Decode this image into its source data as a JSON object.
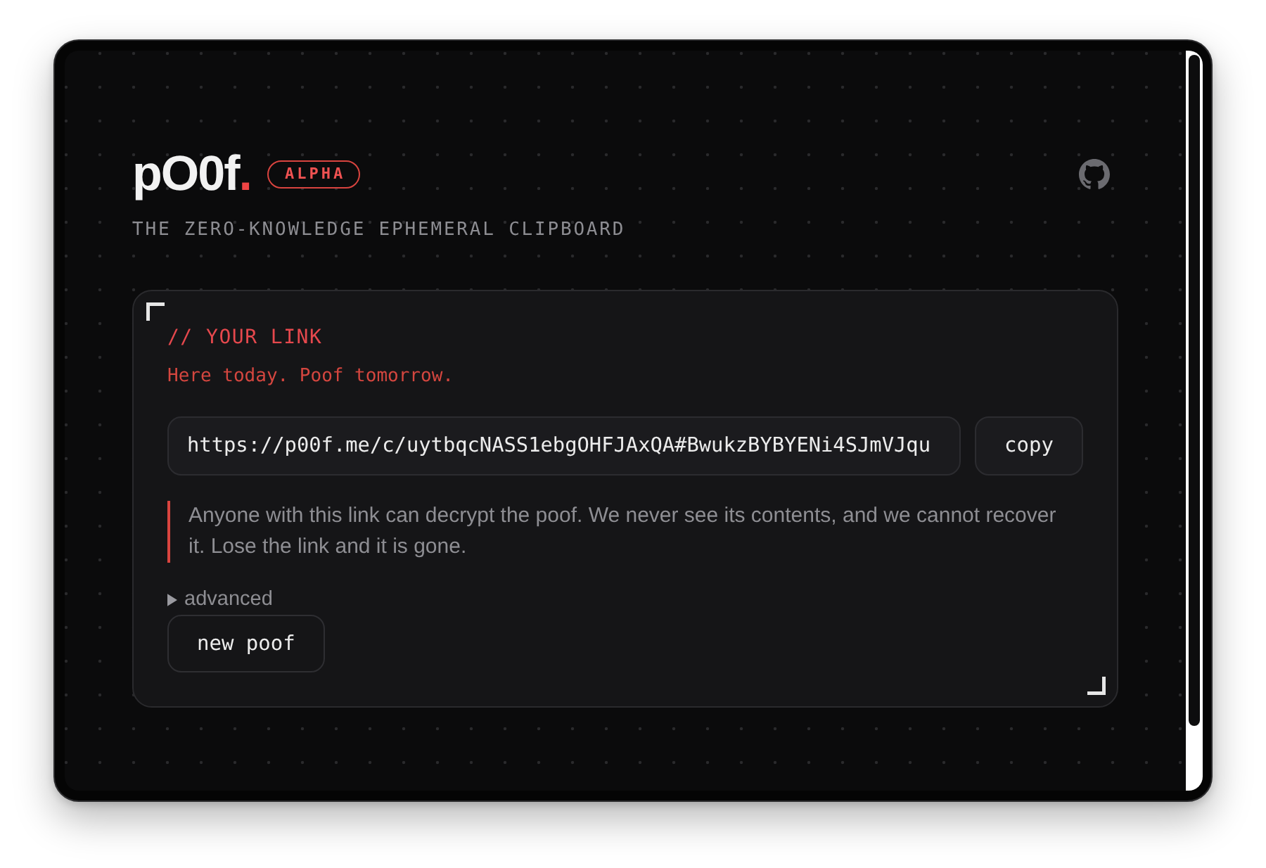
{
  "header": {
    "logo": {
      "text": "pO0f",
      "accent": "."
    },
    "badge": "ALPHA",
    "tagline": "THE ZERO-KNOWLEDGE EPHEMERAL CLIPBOARD"
  },
  "link_card": {
    "label": "// YOUR LINK",
    "subtitle": "Here today. Poof tomorrow.",
    "link_field": {
      "value": "https://p00f.me/c/uytbqcNASS1ebgOHFJAxQA#BwukzBYBYENi4SJmVJqu"
    },
    "copy_button": "copy",
    "note": "Anyone with this link can decrypt the poof. We never see its contents, and we cannot recover it. Lose the link and it is gone.",
    "advanced": {
      "label": "advanced",
      "expanded": false
    },
    "new_button": "new poof"
  }
}
